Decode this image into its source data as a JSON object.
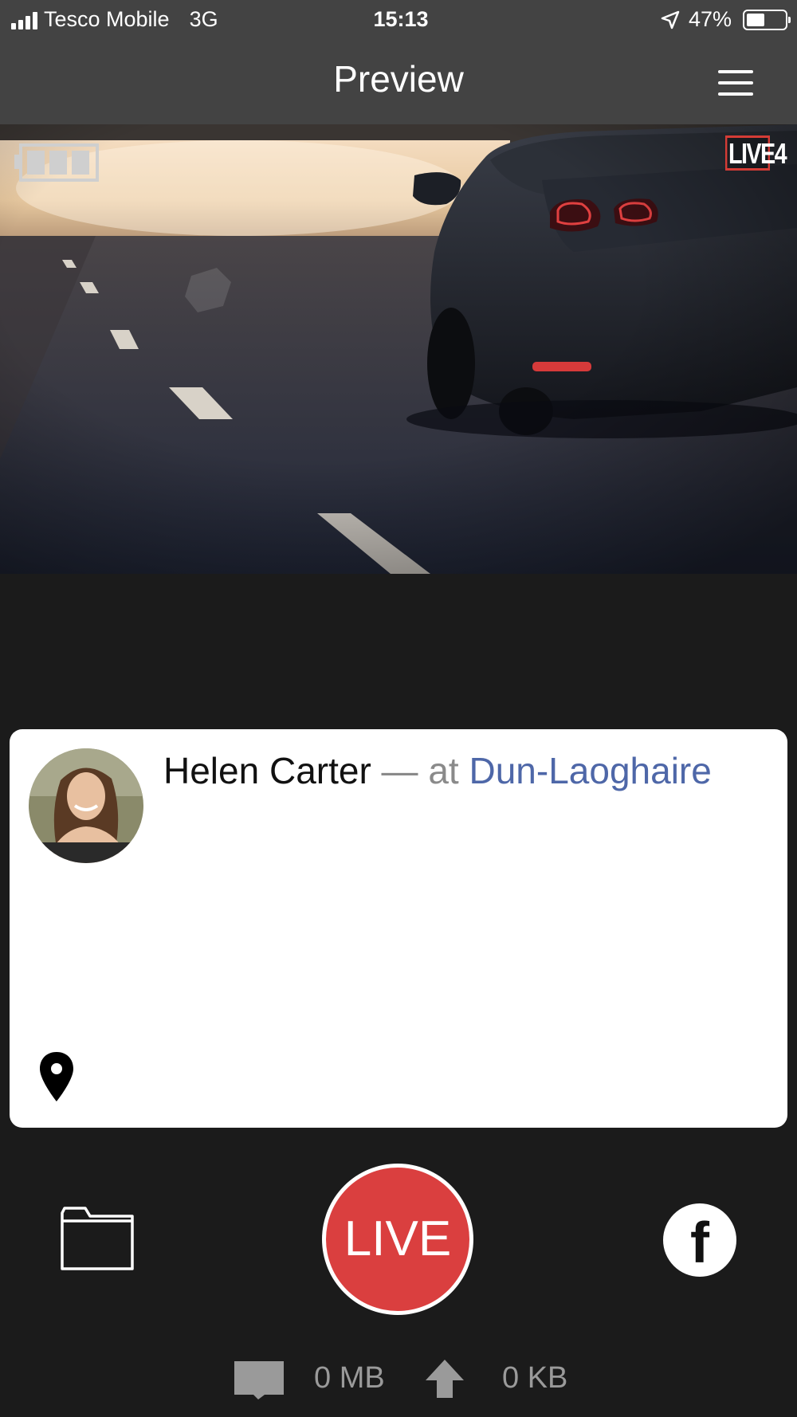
{
  "status_bar": {
    "carrier": "Tesco Mobile",
    "network": "3G",
    "time": "15:13",
    "battery_text": "47%",
    "battery_level": 0.47
  },
  "header": {
    "title": "Preview"
  },
  "preview": {
    "logo_text": "LIVE4",
    "camera_battery_bars": 3
  },
  "post": {
    "name": "Helen Carter",
    "separator": " — at ",
    "place": "Dun-Laoghaire"
  },
  "controls": {
    "live_label": "LIVE",
    "facebook_glyph": "f"
  },
  "stats": {
    "storage_value": "0 MB",
    "upload_value": "0 KB"
  },
  "icons": {
    "signal": "signal-icon",
    "location_arrow": "location-arrow-icon",
    "battery": "battery-icon",
    "menu": "hamburger-menu-icon",
    "pin": "map-pin-icon",
    "folder": "folder-icon",
    "sd_card": "sd-card-icon",
    "upload": "upload-arrow-icon"
  },
  "colors": {
    "live_red": "#da3f3f",
    "place_blue": "#4e67a8",
    "bar_gray": "#434343",
    "background": "#1b1b1b"
  }
}
